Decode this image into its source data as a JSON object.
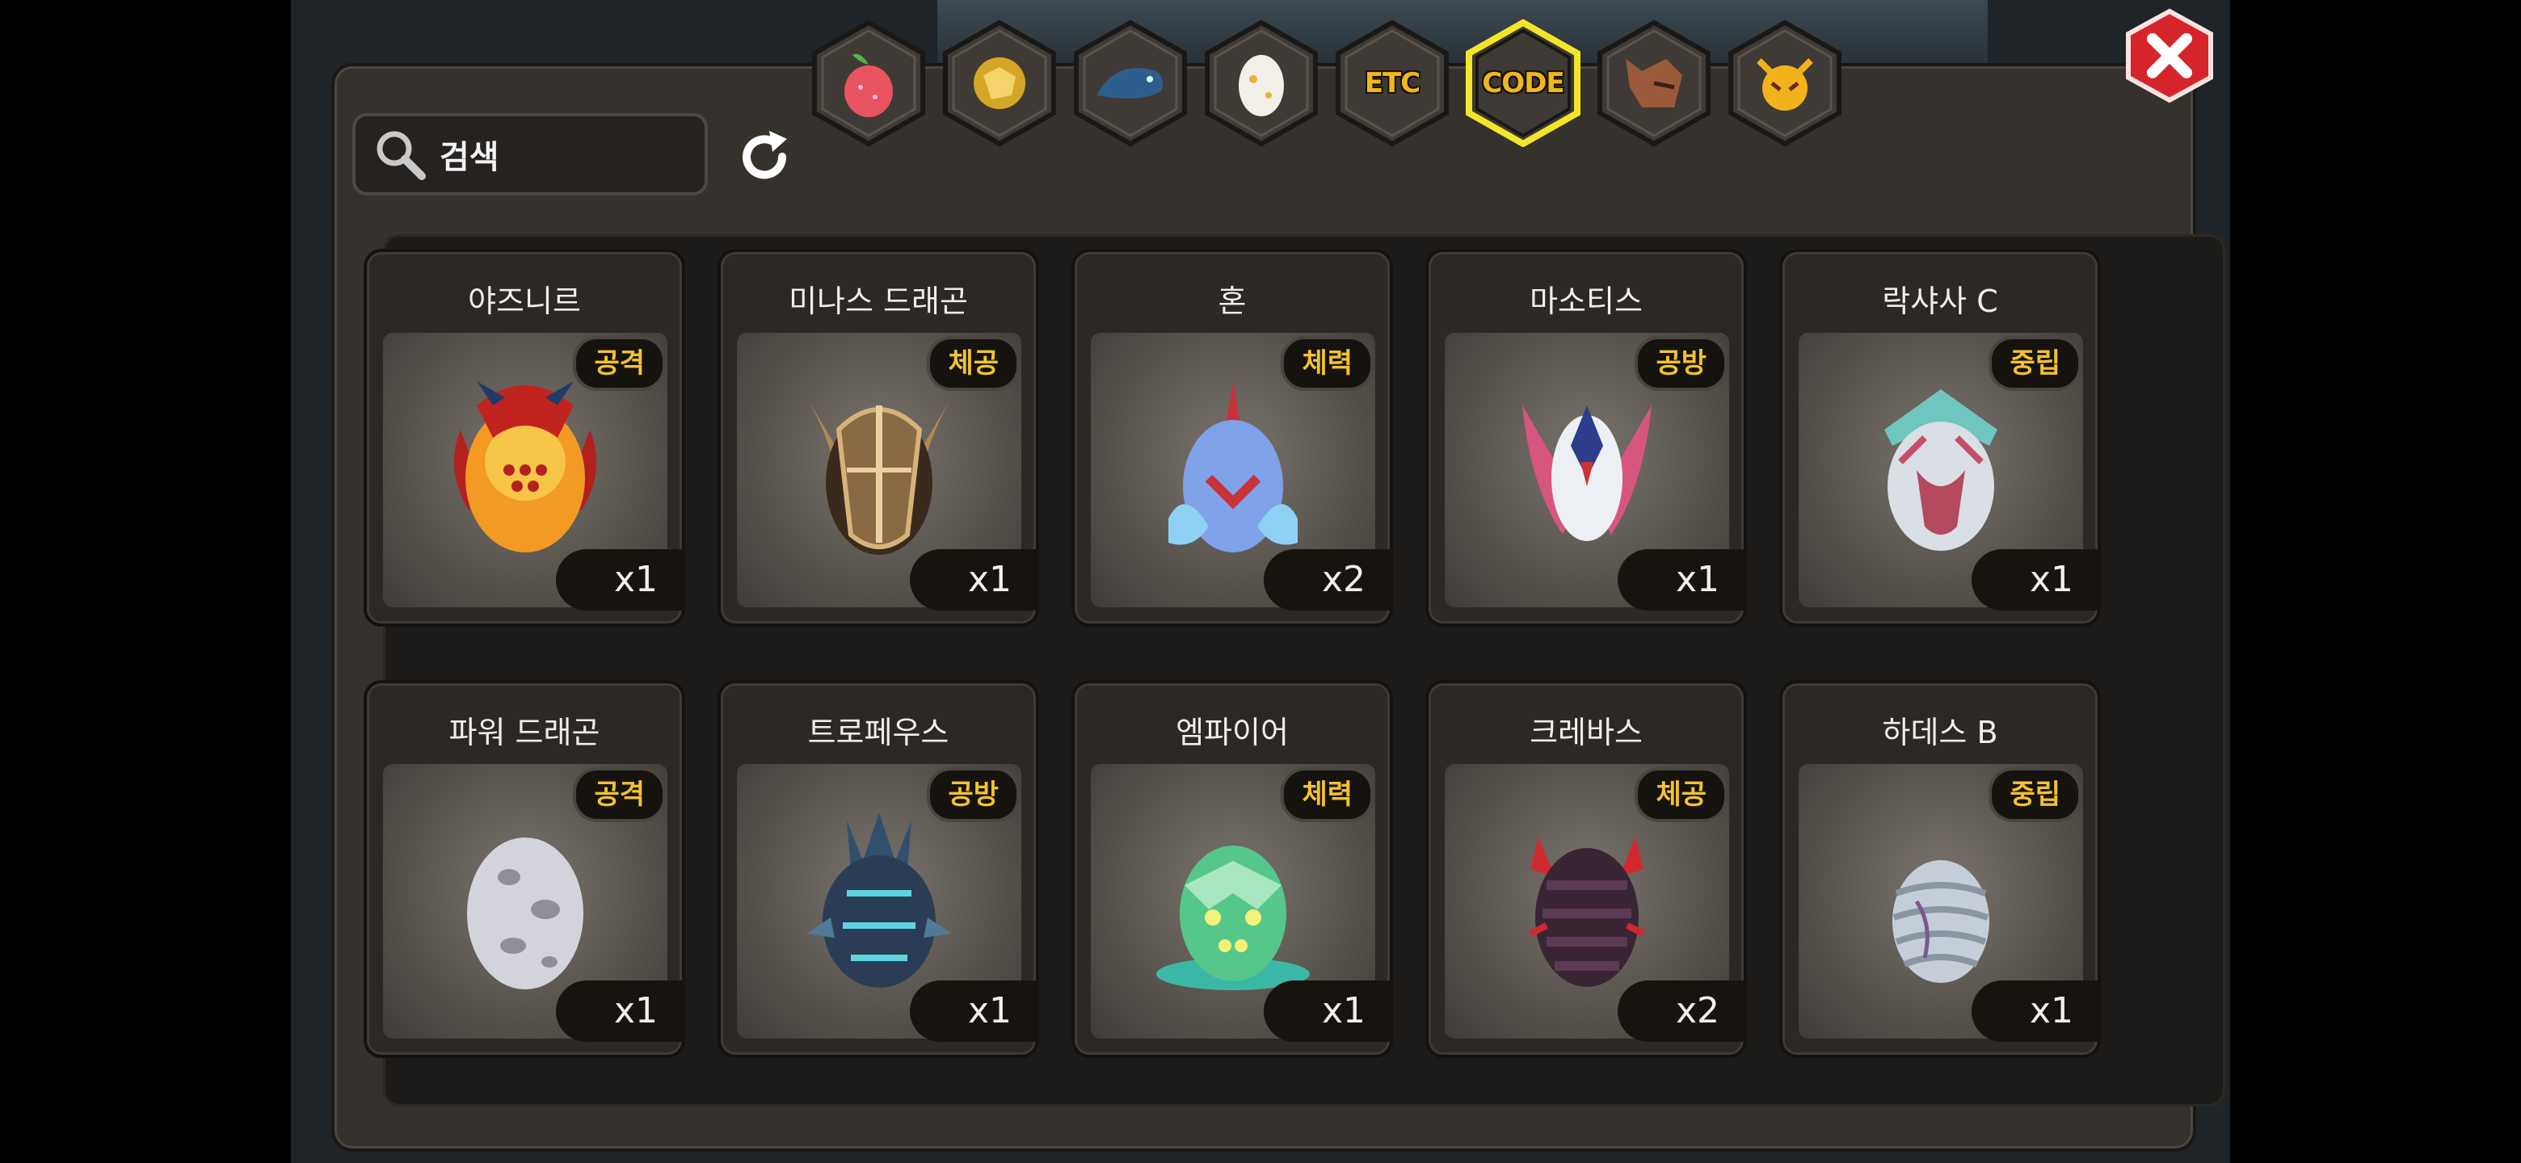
{
  "search": {
    "label": "검색"
  },
  "tabs": [
    {
      "name": "tab-food",
      "icon": "fruit-icon",
      "label": ""
    },
    {
      "name": "tab-gold",
      "icon": "gold-ore-icon",
      "label": ""
    },
    {
      "name": "tab-dragon",
      "icon": "blue-dragon-icon",
      "label": ""
    },
    {
      "name": "tab-egg",
      "icon": "egg-icon",
      "label": ""
    },
    {
      "name": "tab-etc",
      "icon": "",
      "label": "ETC"
    },
    {
      "name": "tab-code",
      "icon": "",
      "label": "CODE",
      "active": true
    },
    {
      "name": "tab-wolf",
      "icon": "wolf-head-icon",
      "label": ""
    },
    {
      "name": "tab-emblem",
      "icon": "golden-face-icon",
      "label": ""
    }
  ],
  "items": [
    {
      "name": "야즈니르",
      "tag": "공격",
      "qty": "x1",
      "icon": "yaznir-egg-icon"
    },
    {
      "name": "미나스 드래곤",
      "tag": "체공",
      "qty": "x1",
      "icon": "minas-dragon-egg-icon"
    },
    {
      "name": "혼",
      "tag": "체력",
      "qty": "x2",
      "icon": "hon-egg-icon"
    },
    {
      "name": "마소티스",
      "tag": "공방",
      "qty": "x1",
      "icon": "masotis-egg-icon"
    },
    {
      "name": "락샤사 C",
      "tag": "중립",
      "qty": "x1",
      "icon": "raksasa-egg-icon"
    },
    {
      "name": "파워 드래곤",
      "tag": "공격",
      "qty": "x1",
      "icon": "power-dragon-egg-icon"
    },
    {
      "name": "트로페우스",
      "tag": "공방",
      "qty": "x1",
      "icon": "tropheus-egg-icon"
    },
    {
      "name": "엠파이어",
      "tag": "체력",
      "qty": "x1",
      "icon": "empire-egg-icon"
    },
    {
      "name": "크레바스",
      "tag": "체공",
      "qty": "x2",
      "icon": "crevasse-egg-icon"
    },
    {
      "name": "하데스 B",
      "tag": "중립",
      "qty": "x1",
      "icon": "hades-egg-icon"
    }
  ],
  "colors": {
    "accent": "#f0b71f",
    "active_ring": "#f5e52a",
    "close": "#d6252a"
  }
}
